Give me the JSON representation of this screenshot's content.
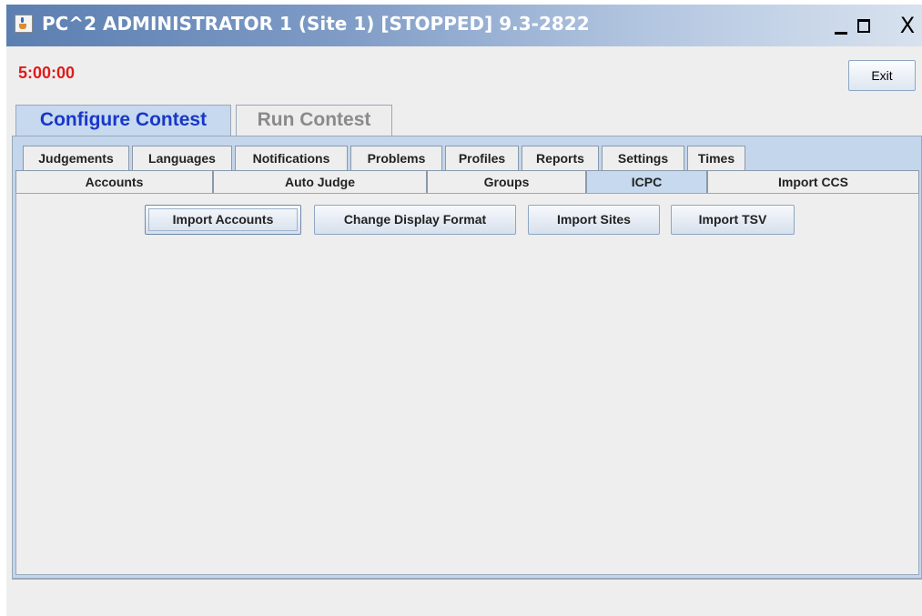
{
  "window": {
    "title": "PC^2 ADMINISTRATOR 1 (Site 1) [STOPPED] 9.3-2822",
    "close_glyph": "X"
  },
  "header": {
    "timer": "5:00:00",
    "exit_label": "Exit"
  },
  "main_tabs": [
    {
      "label": "Configure Contest",
      "active": true
    },
    {
      "label": "Run Contest",
      "active": false
    }
  ],
  "sub_tabs_row1": [
    "Judgements",
    "Languages",
    "Notifications",
    "Problems",
    "Profiles",
    "Reports",
    "Settings",
    "Times"
  ],
  "sub_tabs_row2": [
    "Accounts",
    "Auto Judge",
    "Groups",
    "ICPC",
    "Import CCS"
  ],
  "selected_sub_tab": "ICPC",
  "actions": {
    "import_accounts": "Import Accounts",
    "change_display_format": "Change Display Format",
    "import_sites": "Import Sites",
    "import_tsv": "Import TSV"
  },
  "colors": {
    "timer": "#e01b1b",
    "active_tab_text": "#1937c8",
    "selected_tab_bg": "#c6d9ee"
  },
  "icons": {
    "app": "java-coffee-cup-icon",
    "minimize": "minimize-icon",
    "maximize": "maximize-icon",
    "close": "close-icon"
  }
}
